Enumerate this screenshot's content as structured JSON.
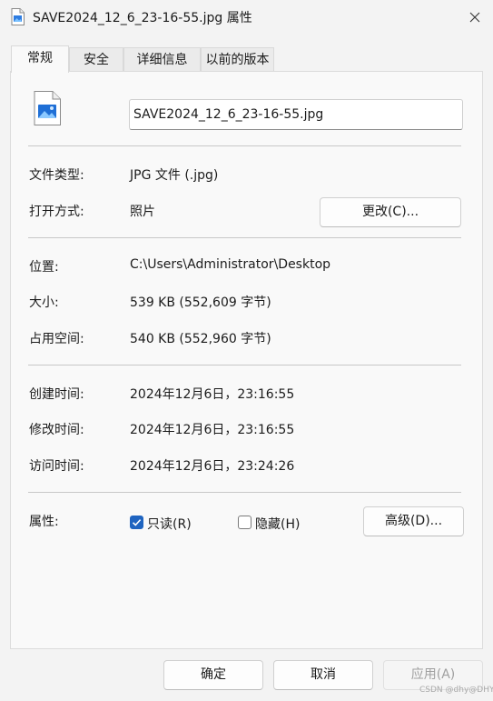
{
  "window": {
    "title": "SAVE2024_12_6_23-16-55.jpg 属性"
  },
  "tabs": [
    {
      "label": "常规",
      "active": true
    },
    {
      "label": "安全",
      "active": false
    },
    {
      "label": "详细信息",
      "active": false
    },
    {
      "label": "以前的版本",
      "active": false
    }
  ],
  "general": {
    "file_name": "SAVE2024_12_6_23-16-55.jpg",
    "file_type_label": "文件类型:",
    "file_type_value": "JPG 文件 (.jpg)",
    "open_with_label": "打开方式:",
    "open_with_value": "照片",
    "change_button": "更改(C)...",
    "location_label": "位置:",
    "location_value": "C:\\Users\\Administrator\\Desktop",
    "size_label": "大小:",
    "size_value": "539 KB (552,609 字节)",
    "disk_size_label": "占用空间:",
    "disk_size_value": "540 KB (552,960 字节)",
    "created_label": "创建时间:",
    "created_value": "2024年12月6日，23:16:55",
    "modified_label": "修改时间:",
    "modified_value": "2024年12月6日，23:16:55",
    "accessed_label": "访问时间:",
    "accessed_value": "2024年12月6日，23:24:26",
    "attributes_label": "属性:",
    "readonly_label": "只读(R)",
    "readonly_checked": true,
    "hidden_label": "隐藏(H)",
    "hidden_checked": false,
    "advanced_button": "高级(D)..."
  },
  "footer": {
    "ok": "确定",
    "cancel": "取消",
    "apply": "应用(A)"
  },
  "watermark": "CSDN @dhy@DHY",
  "colors": {
    "accent": "#1f64c0",
    "window_bg": "#f3f3f3",
    "panel_bg": "#f9f9f9"
  }
}
